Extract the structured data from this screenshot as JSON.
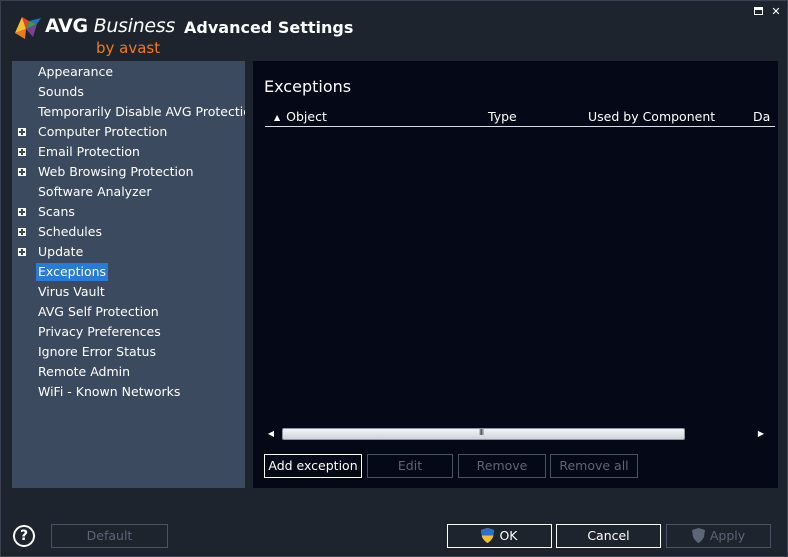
{
  "header": {
    "brand_main": "AVG",
    "brand_sub": "Business",
    "brand_tagline": "by avast",
    "window_title": "Advanced Settings"
  },
  "sidebar": {
    "items": [
      {
        "label": "Appearance",
        "expandable": false,
        "selected": false
      },
      {
        "label": "Sounds",
        "expandable": false,
        "selected": false
      },
      {
        "label": "Temporarily Disable AVG Protection",
        "expandable": false,
        "selected": false
      },
      {
        "label": "Computer Protection",
        "expandable": true,
        "selected": false
      },
      {
        "label": "Email Protection",
        "expandable": true,
        "selected": false
      },
      {
        "label": "Web Browsing Protection",
        "expandable": true,
        "selected": false
      },
      {
        "label": "Software Analyzer",
        "expandable": false,
        "selected": false
      },
      {
        "label": "Scans",
        "expandable": true,
        "selected": false
      },
      {
        "label": "Schedules",
        "expandable": true,
        "selected": false
      },
      {
        "label": "Update",
        "expandable": true,
        "selected": false
      },
      {
        "label": "Exceptions",
        "expandable": false,
        "selected": true
      },
      {
        "label": "Virus Vault",
        "expandable": false,
        "selected": false
      },
      {
        "label": "AVG Self Protection",
        "expandable": false,
        "selected": false
      },
      {
        "label": "Privacy Preferences",
        "expandable": false,
        "selected": false
      },
      {
        "label": "Ignore Error Status",
        "expandable": false,
        "selected": false
      },
      {
        "label": "Remote Admin",
        "expandable": false,
        "selected": false
      },
      {
        "label": "WiFi - Known Networks",
        "expandable": false,
        "selected": false
      }
    ]
  },
  "main": {
    "title": "Exceptions",
    "columns": {
      "object": "Object",
      "type": "Type",
      "used_by": "Used by Component",
      "date": "Da"
    },
    "scroll_grip": "III",
    "buttons": {
      "add": "Add exception",
      "edit": "Edit",
      "remove": "Remove",
      "remove_all": "Remove all"
    }
  },
  "footer": {
    "help": "?",
    "default": "Default",
    "ok": "OK",
    "cancel": "Cancel",
    "apply": "Apply"
  },
  "colors": {
    "selected": "#2a7ad8",
    "sidebar_bg": "#3c4a5f",
    "panel_bg": "#050816",
    "brand_orange": "#f07a1d"
  }
}
